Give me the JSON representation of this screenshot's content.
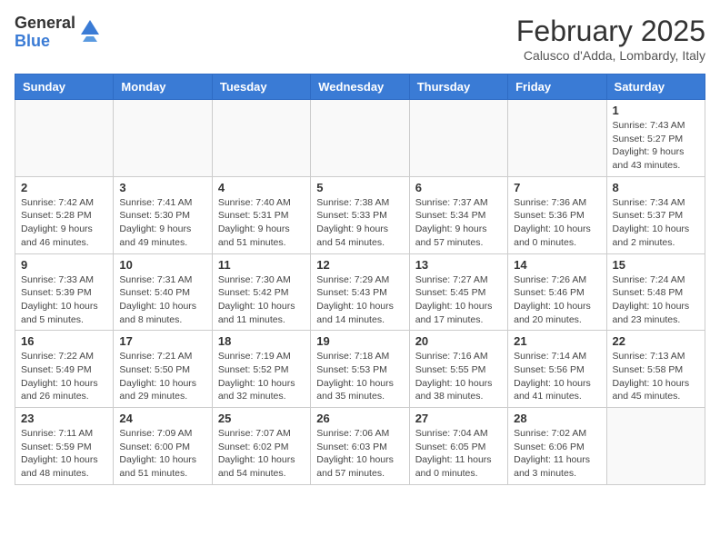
{
  "logo": {
    "general": "General",
    "blue": "Blue"
  },
  "header": {
    "month": "February 2025",
    "location": "Calusco d'Adda, Lombardy, Italy"
  },
  "weekdays": [
    "Sunday",
    "Monday",
    "Tuesday",
    "Wednesday",
    "Thursday",
    "Friday",
    "Saturday"
  ],
  "weeks": [
    [
      {
        "day": "",
        "info": ""
      },
      {
        "day": "",
        "info": ""
      },
      {
        "day": "",
        "info": ""
      },
      {
        "day": "",
        "info": ""
      },
      {
        "day": "",
        "info": ""
      },
      {
        "day": "",
        "info": ""
      },
      {
        "day": "1",
        "info": "Sunrise: 7:43 AM\nSunset: 5:27 PM\nDaylight: 9 hours\nand 43 minutes."
      }
    ],
    [
      {
        "day": "2",
        "info": "Sunrise: 7:42 AM\nSunset: 5:28 PM\nDaylight: 9 hours\nand 46 minutes."
      },
      {
        "day": "3",
        "info": "Sunrise: 7:41 AM\nSunset: 5:30 PM\nDaylight: 9 hours\nand 49 minutes."
      },
      {
        "day": "4",
        "info": "Sunrise: 7:40 AM\nSunset: 5:31 PM\nDaylight: 9 hours\nand 51 minutes."
      },
      {
        "day": "5",
        "info": "Sunrise: 7:38 AM\nSunset: 5:33 PM\nDaylight: 9 hours\nand 54 minutes."
      },
      {
        "day": "6",
        "info": "Sunrise: 7:37 AM\nSunset: 5:34 PM\nDaylight: 9 hours\nand 57 minutes."
      },
      {
        "day": "7",
        "info": "Sunrise: 7:36 AM\nSunset: 5:36 PM\nDaylight: 10 hours\nand 0 minutes."
      },
      {
        "day": "8",
        "info": "Sunrise: 7:34 AM\nSunset: 5:37 PM\nDaylight: 10 hours\nand 2 minutes."
      }
    ],
    [
      {
        "day": "9",
        "info": "Sunrise: 7:33 AM\nSunset: 5:39 PM\nDaylight: 10 hours\nand 5 minutes."
      },
      {
        "day": "10",
        "info": "Sunrise: 7:31 AM\nSunset: 5:40 PM\nDaylight: 10 hours\nand 8 minutes."
      },
      {
        "day": "11",
        "info": "Sunrise: 7:30 AM\nSunset: 5:42 PM\nDaylight: 10 hours\nand 11 minutes."
      },
      {
        "day": "12",
        "info": "Sunrise: 7:29 AM\nSunset: 5:43 PM\nDaylight: 10 hours\nand 14 minutes."
      },
      {
        "day": "13",
        "info": "Sunrise: 7:27 AM\nSunset: 5:45 PM\nDaylight: 10 hours\nand 17 minutes."
      },
      {
        "day": "14",
        "info": "Sunrise: 7:26 AM\nSunset: 5:46 PM\nDaylight: 10 hours\nand 20 minutes."
      },
      {
        "day": "15",
        "info": "Sunrise: 7:24 AM\nSunset: 5:48 PM\nDaylight: 10 hours\nand 23 minutes."
      }
    ],
    [
      {
        "day": "16",
        "info": "Sunrise: 7:22 AM\nSunset: 5:49 PM\nDaylight: 10 hours\nand 26 minutes."
      },
      {
        "day": "17",
        "info": "Sunrise: 7:21 AM\nSunset: 5:50 PM\nDaylight: 10 hours\nand 29 minutes."
      },
      {
        "day": "18",
        "info": "Sunrise: 7:19 AM\nSunset: 5:52 PM\nDaylight: 10 hours\nand 32 minutes."
      },
      {
        "day": "19",
        "info": "Sunrise: 7:18 AM\nSunset: 5:53 PM\nDaylight: 10 hours\nand 35 minutes."
      },
      {
        "day": "20",
        "info": "Sunrise: 7:16 AM\nSunset: 5:55 PM\nDaylight: 10 hours\nand 38 minutes."
      },
      {
        "day": "21",
        "info": "Sunrise: 7:14 AM\nSunset: 5:56 PM\nDaylight: 10 hours\nand 41 minutes."
      },
      {
        "day": "22",
        "info": "Sunrise: 7:13 AM\nSunset: 5:58 PM\nDaylight: 10 hours\nand 45 minutes."
      }
    ],
    [
      {
        "day": "23",
        "info": "Sunrise: 7:11 AM\nSunset: 5:59 PM\nDaylight: 10 hours\nand 48 minutes."
      },
      {
        "day": "24",
        "info": "Sunrise: 7:09 AM\nSunset: 6:00 PM\nDaylight: 10 hours\nand 51 minutes."
      },
      {
        "day": "25",
        "info": "Sunrise: 7:07 AM\nSunset: 6:02 PM\nDaylight: 10 hours\nand 54 minutes."
      },
      {
        "day": "26",
        "info": "Sunrise: 7:06 AM\nSunset: 6:03 PM\nDaylight: 10 hours\nand 57 minutes."
      },
      {
        "day": "27",
        "info": "Sunrise: 7:04 AM\nSunset: 6:05 PM\nDaylight: 11 hours\nand 0 minutes."
      },
      {
        "day": "28",
        "info": "Sunrise: 7:02 AM\nSunset: 6:06 PM\nDaylight: 11 hours\nand 3 minutes."
      },
      {
        "day": "",
        "info": ""
      }
    ]
  ]
}
